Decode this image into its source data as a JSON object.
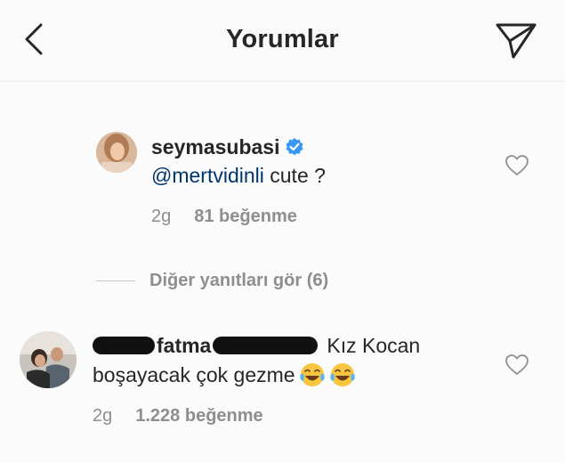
{
  "header": {
    "title": "Yorumlar",
    "back_icon": "chevron-left-icon",
    "send_icon": "paper-plane-icon"
  },
  "comment1": {
    "username": "seymasubasi",
    "verified_icon": "verified-badge-icon",
    "mention": "@mertvidinli",
    "text": " cute ?",
    "time": "2g",
    "likes": "81 beğenme"
  },
  "view_replies": {
    "label": "Diğer yanıtları gör (6)"
  },
  "comment2": {
    "username_visible": "fatma",
    "text_line1": "Kız Kocan",
    "text_line2": "boşayacak çok gezme",
    "emoji": "face-with-tears-of-joy",
    "time": "2g",
    "likes": "1.228 beğenme"
  },
  "colors": {
    "text": "#262626",
    "secondary": "#8e8e8e",
    "mention": "#00376b",
    "verified": "#3897f0"
  }
}
